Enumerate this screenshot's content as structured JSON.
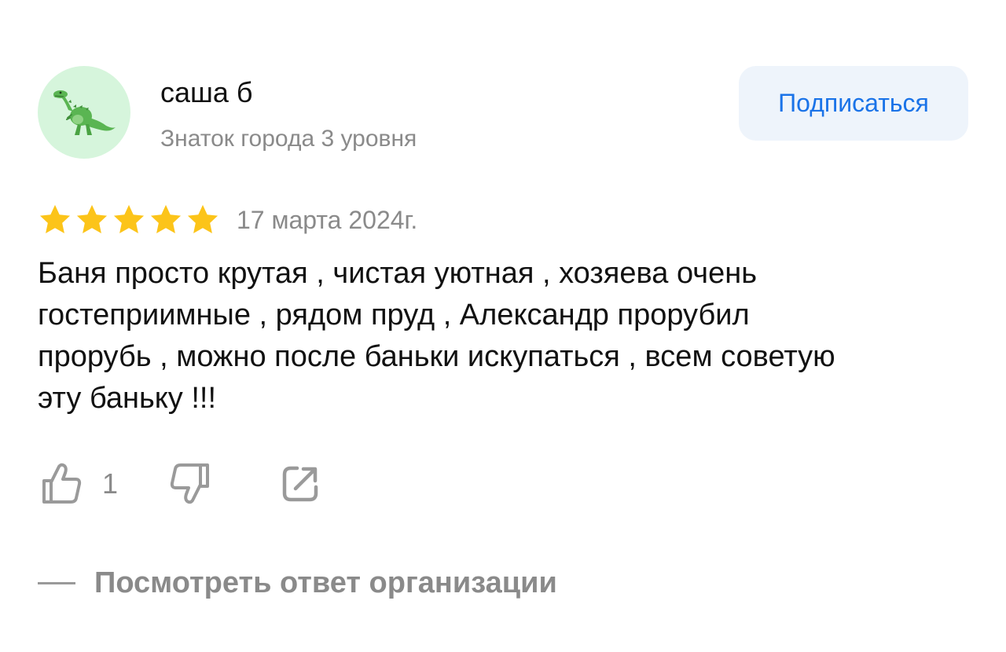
{
  "author": {
    "name": "саша б",
    "level": "Знаток города 3 уровня",
    "avatar_icon": "dinosaur-icon"
  },
  "subscribe_button": {
    "label": "Подписаться"
  },
  "rating": {
    "stars": 5,
    "max_stars": 5,
    "date": "17 марта 2024г."
  },
  "review": {
    "text": "Баня просто крутая , чистая уютная , хозяева очень\nгостеприимные , рядом пруд , Александр  прорубил\nпрорубь , можно после баньки искупаться , всем советую\nэту баньку !!!"
  },
  "actions": {
    "like_count": "1",
    "like_icon": "thumbs-up-icon",
    "dislike_icon": "thumbs-down-icon",
    "share_icon": "share-icon"
  },
  "org_reply": {
    "label": "Посмотреть ответ организации"
  },
  "colors": {
    "accent": "#1a73e8",
    "star": "#fcc419",
    "muted_text": "#8a8a8a",
    "button_bg": "#eef4fb",
    "avatar_bg": "#d6f5dc"
  }
}
